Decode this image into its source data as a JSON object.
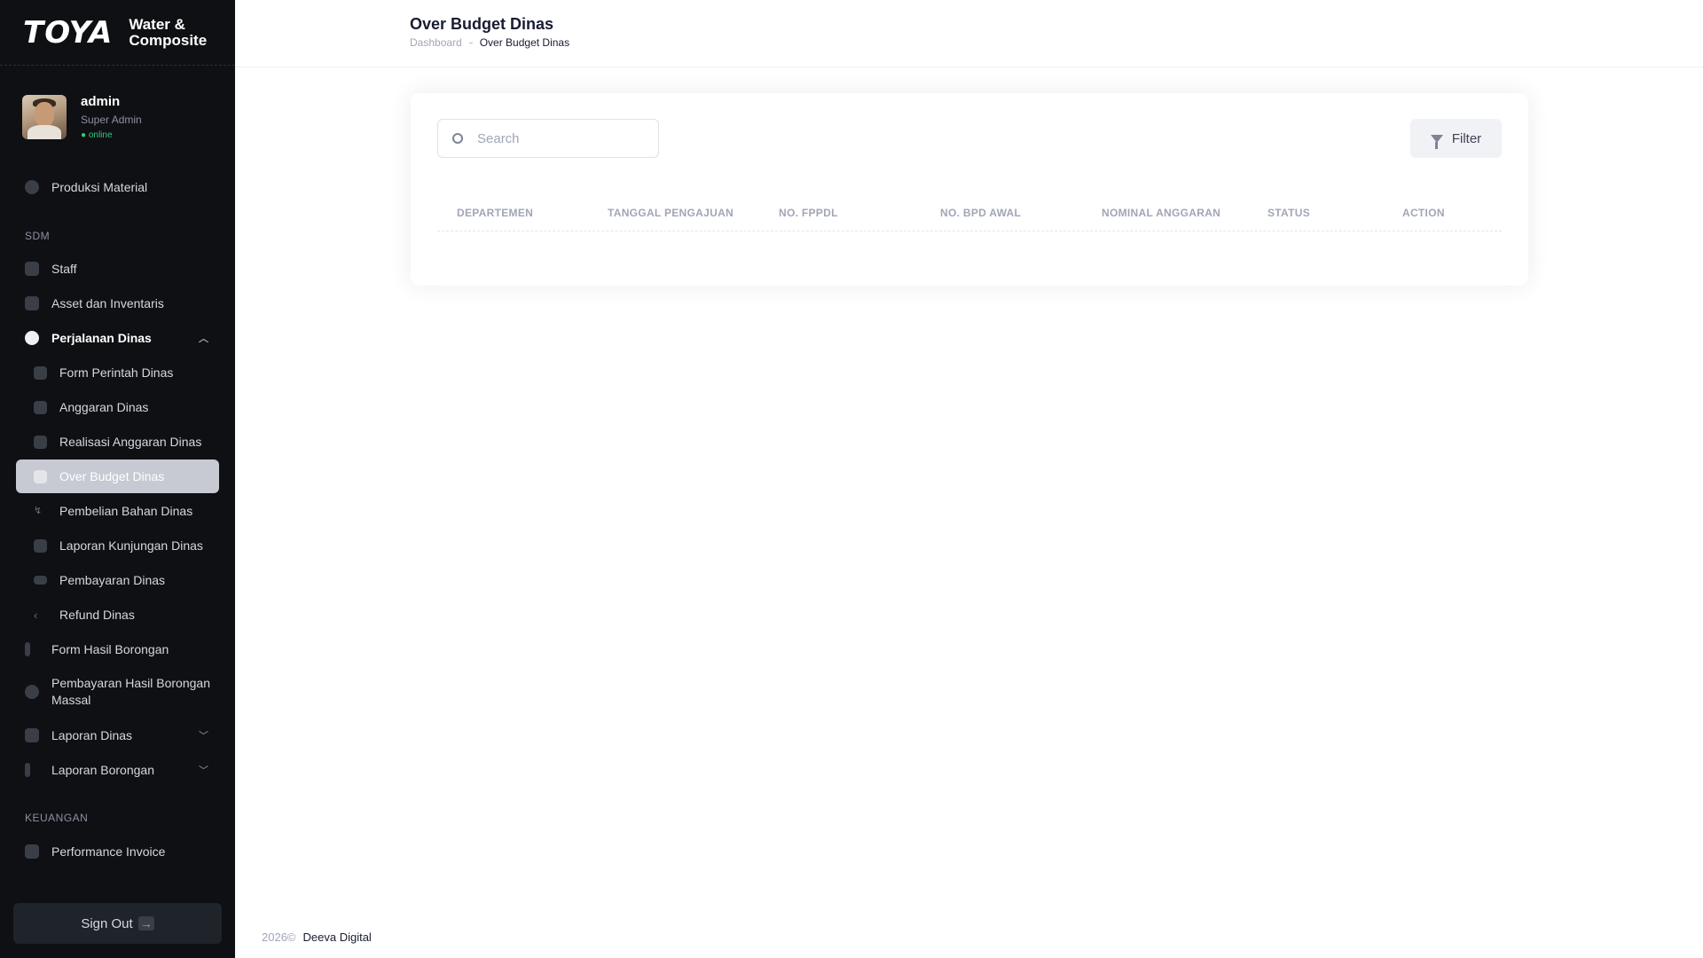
{
  "brand": {
    "logo": "TOYA",
    "name_line1": "Water &",
    "name_line2": "Composite"
  },
  "user": {
    "name": "admin",
    "role": "Super Admin",
    "status": "● online"
  },
  "sidebar": {
    "items": [
      {
        "label": "Produksi Material",
        "icon": "circle-icon"
      },
      {
        "section": "SDM"
      },
      {
        "label": "Staff",
        "icon": "user-icon"
      },
      {
        "label": "Asset dan Inventaris",
        "icon": "layers-icon"
      },
      {
        "label": "Perjalanan Dinas",
        "icon": "briefcase-icon",
        "open": true
      },
      {
        "label": "Form Perintah Dinas",
        "icon": "briefcase-icon",
        "sub": true
      },
      {
        "label": "Anggaran Dinas",
        "icon": "calendar-icon",
        "sub": true
      },
      {
        "label": "Realisasi Anggaran Dinas",
        "icon": "briefcase-icon",
        "sub": true
      },
      {
        "label": "Over Budget Dinas",
        "icon": "chart-icon",
        "sub": true,
        "active": true
      },
      {
        "label": "Pembelian Bahan Dinas",
        "icon": "bolt-icon",
        "sub": true
      },
      {
        "label": "Laporan Kunjungan Dinas",
        "icon": "edit-icon",
        "sub": true
      },
      {
        "label": "Pembayaran Dinas",
        "icon": "camera-icon",
        "sub": true
      },
      {
        "label": "Refund Dinas",
        "icon": "chevron-left-icon",
        "sub": true
      },
      {
        "label": "Form Hasil Borongan",
        "icon": "bar-chart-icon"
      },
      {
        "label": "Pembayaran Hasil Borongan Massal",
        "icon": "dollar-icon"
      },
      {
        "label": "Laporan Dinas",
        "icon": "briefcase-icon",
        "collapsible": true
      },
      {
        "label": "Laporan Borongan",
        "icon": "bar-chart-icon",
        "collapsible": true
      },
      {
        "section": "KEUANGAN"
      },
      {
        "label": "Performance Invoice",
        "icon": "document-icon"
      }
    ],
    "signout_label": "Sign Out",
    "signout_arrow": "→"
  },
  "header": {
    "title": "Over Budget Dinas",
    "breadcrumb": {
      "home": "Dashboard",
      "current": "Over Budget Dinas"
    }
  },
  "main": {
    "search_placeholder": "Search",
    "filter_label": "Filter",
    "columns": [
      "DEPARTEMEN",
      "TANGGAL PENGAJUAN",
      "NO. FPPDL",
      "NO. BPD AWAL",
      "NOMINAL ANGGARAN",
      "STATUS",
      "ACTION"
    ]
  },
  "footer": {
    "year": "2026©",
    "company": "Deeva Digital"
  }
}
